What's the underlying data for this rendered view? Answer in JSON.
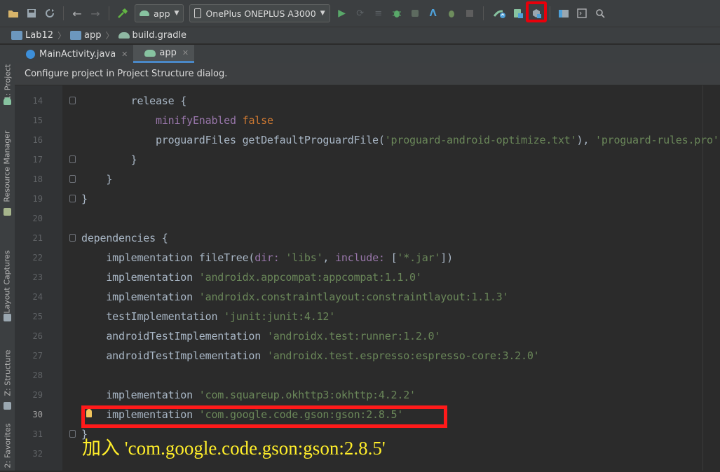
{
  "toolbar": {
    "run_config": "app",
    "device": "OnePlus ONEPLUS A3000",
    "highlighted_button": "sync-project-with-gradle"
  },
  "breadcrumb": [
    "Lab12",
    "app",
    "build.gradle"
  ],
  "left_tabs": [
    "1: Project",
    "Resource Manager",
    "Layout Captures",
    "Z: Structure",
    "2: Favorites"
  ],
  "tabs": [
    {
      "label": "MainActivity.java",
      "active": false
    },
    {
      "label": "app",
      "active": true
    }
  ],
  "notification": "Configure project in Project Structure dialog.",
  "code_lines": [
    {
      "num": "14",
      "parts": [
        {
          "t": "        release {",
          "c": "plain"
        }
      ]
    },
    {
      "num": "15",
      "parts": [
        {
          "t": "            ",
          "c": "plain"
        },
        {
          "t": "minifyEnabled ",
          "c": "meth"
        },
        {
          "t": "false",
          "c": "kw"
        }
      ]
    },
    {
      "num": "16",
      "parts": [
        {
          "t": "            proguardFiles getDefaultProguardFile(",
          "c": "plain"
        },
        {
          "t": "'proguard-android-optimize.txt'",
          "c": "str"
        },
        {
          "t": "), ",
          "c": "plain"
        },
        {
          "t": "'proguard-rules.pro'",
          "c": "str"
        }
      ]
    },
    {
      "num": "17",
      "parts": [
        {
          "t": "        }",
          "c": "plain"
        }
      ]
    },
    {
      "num": "18",
      "parts": [
        {
          "t": "    }",
          "c": "plain"
        }
      ]
    },
    {
      "num": "19",
      "parts": [
        {
          "t": "}",
          "c": "plain"
        }
      ]
    },
    {
      "num": "20",
      "parts": [
        {
          "t": "",
          "c": "plain"
        }
      ]
    },
    {
      "num": "21",
      "parts": [
        {
          "t": "dependencies {",
          "c": "plain"
        }
      ]
    },
    {
      "num": "22",
      "parts": [
        {
          "t": "    implementation fileTree(",
          "c": "plain"
        },
        {
          "t": "dir: ",
          "c": "meth"
        },
        {
          "t": "'libs'",
          "c": "str"
        },
        {
          "t": ", ",
          "c": "plain"
        },
        {
          "t": "include: ",
          "c": "meth"
        },
        {
          "t": "[",
          "c": "plain"
        },
        {
          "t": "'*.jar'",
          "c": "str"
        },
        {
          "t": "])",
          "c": "plain"
        }
      ]
    },
    {
      "num": "23",
      "parts": [
        {
          "t": "    implementation ",
          "c": "plain"
        },
        {
          "t": "'androidx.appcompat:appcompat:1.1.0'",
          "c": "str"
        }
      ]
    },
    {
      "num": "24",
      "parts": [
        {
          "t": "    implementation ",
          "c": "plain"
        },
        {
          "t": "'androidx.constraintlayout:constraintlayout:1.1.3'",
          "c": "str"
        }
      ]
    },
    {
      "num": "25",
      "parts": [
        {
          "t": "    testImplementation ",
          "c": "plain"
        },
        {
          "t": "'junit:junit:4.12'",
          "c": "str"
        }
      ]
    },
    {
      "num": "26",
      "parts": [
        {
          "t": "    androidTestImplementation ",
          "c": "plain"
        },
        {
          "t": "'androidx.test:runner:1.2.0'",
          "c": "str"
        }
      ]
    },
    {
      "num": "27",
      "parts": [
        {
          "t": "    androidTestImplementation ",
          "c": "plain"
        },
        {
          "t": "'androidx.test.espresso:espresso-core:3.2.0'",
          "c": "str"
        }
      ]
    },
    {
      "num": "28",
      "parts": [
        {
          "t": "",
          "c": "plain"
        }
      ]
    },
    {
      "num": "29",
      "parts": [
        {
          "t": "    implementation ",
          "c": "plain"
        },
        {
          "t": "'com.squareup.okhttp3:okhttp:4.2.2'",
          "c": "str"
        }
      ]
    },
    {
      "num": "30",
      "parts": [
        {
          "t": "    implementation ",
          "c": "plain"
        },
        {
          "t": "'com.google.code.gson:gson:2.8.5'",
          "c": "str"
        }
      ],
      "current": true
    },
    {
      "num": "31",
      "parts": [
        {
          "t": "}",
          "c": "plain"
        }
      ]
    },
    {
      "num": "32",
      "parts": [
        {
          "t": "",
          "c": "plain"
        }
      ]
    }
  ],
  "annotation": "加入 'com.google.code.gson:gson:2.8.5'"
}
